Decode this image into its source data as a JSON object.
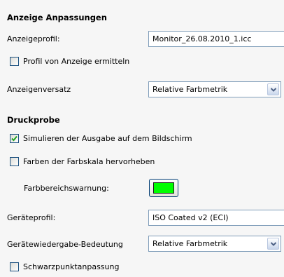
{
  "display": {
    "section_title": "Anzeige Anpassungen",
    "profile_label": "Anzeigeprofil:",
    "profile_value": "Monitor_26.08.2010_1.icc",
    "detect_profile_label": "Profil von Anzeige ermitteln",
    "detect_profile_checked": false,
    "intent_label": "Anzeigenversatz",
    "intent_value": "Relative Farbmetrik"
  },
  "proof": {
    "section_title": "Druckprobe",
    "simulate_label": "Simulieren der Ausgabe auf dem Bildschirm",
    "simulate_checked": true,
    "highlight_gamut_label": "Farben der Farbskala hervorheben",
    "highlight_gamut_checked": false,
    "gamut_warning_label": "Farbbereichswarnung:",
    "gamut_warning_color": "#00ff00",
    "device_profile_label": "Geräteprofil:",
    "device_profile_value": "ISO Coated v2 (ECI)",
    "device_intent_label": "Gerätewiedergabe-Bedeutung",
    "device_intent_value": "Relative Farbmetrik",
    "black_point_label": "Schwarzpunktanpassung",
    "black_point_checked": false
  },
  "icons": {
    "dropdown_arrow": "chevron-down-icon",
    "checkmark": "checkmark-icon"
  },
  "colors": {
    "checkbox_border": "#1c5180",
    "check_mark": "#21a121",
    "field_border": "#7f9db9"
  }
}
